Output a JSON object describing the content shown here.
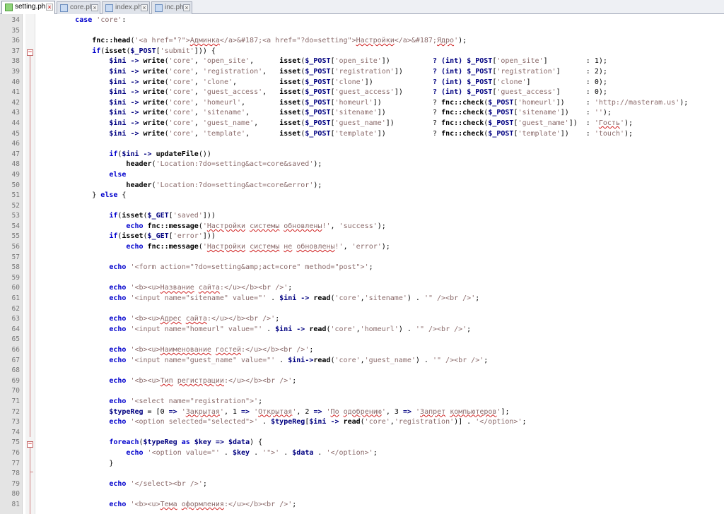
{
  "tabs": [
    {
      "label": "setting.php",
      "active": true
    },
    {
      "label": "core.php",
      "active": false
    },
    {
      "label": "index.php",
      "active": false
    },
    {
      "label": "inc.php",
      "active": false
    }
  ],
  "lines": [
    {
      "n": "34",
      "t": "        case 'core':"
    },
    {
      "n": "35",
      "t": ""
    },
    {
      "n": "36",
      "t": "            fnc::head('<a href=\"?\">Админка</a>&#187;<a href=\"?do=setting\">Настройки</a>&#187;Ядро');"
    },
    {
      "n": "37",
      "t": "            if(isset($_POST['submit'])) {"
    },
    {
      "n": "38",
      "t": "                $ini -> write('core', 'open_site',      isset($_POST['open_site'])          ? (int) $_POST['open_site']         : 1);"
    },
    {
      "n": "39",
      "t": "                $ini -> write('core', 'registration',   isset($_POST['registration'])       ? (int) $_POST['registration']      : 2);"
    },
    {
      "n": "40",
      "t": "                $ini -> write('core', 'clone',          isset($_POST['clone'])              ? (int) $_POST['clone']             : 0);"
    },
    {
      "n": "41",
      "t": "                $ini -> write('core', 'guest_access',   isset($_POST['guest_access'])       ? (int) $_POST['guest_access']      : 0);"
    },
    {
      "n": "42",
      "t": "                $ini -> write('core', 'homeurl',        isset($_POST['homeurl'])            ? fnc::check($_POST['homeurl'])     : 'http://masteram.us');"
    },
    {
      "n": "43",
      "t": "                $ini -> write('core', 'sitename',       isset($_POST['sitename'])           ? fnc::check($_POST['sitename'])    : '');"
    },
    {
      "n": "44",
      "t": "                $ini -> write('core', 'guest_name',     isset($_POST['guest_name'])         ? fnc::check($_POST['guest_name'])  : 'Гость');"
    },
    {
      "n": "45",
      "t": "                $ini -> write('core', 'template',       isset($_POST['template'])           ? fnc::check($_POST['template'])    : 'touch');"
    },
    {
      "n": "46",
      "t": ""
    },
    {
      "n": "47",
      "t": "                if($ini -> updateFile())"
    },
    {
      "n": "48",
      "t": "                    header('Location:?do=setting&act=core&saved');"
    },
    {
      "n": "49",
      "t": "                else"
    },
    {
      "n": "50",
      "t": "                    header('Location:?do=setting&act=core&error');"
    },
    {
      "n": "51",
      "t": "            } else {"
    },
    {
      "n": "52",
      "t": ""
    },
    {
      "n": "53",
      "t": "                if(isset($_GET['saved']))"
    },
    {
      "n": "54",
      "t": "                    echo fnc::message('Настройки системы обновлены!', 'success');"
    },
    {
      "n": "55",
      "t": "                if(isset($_GET['error']))"
    },
    {
      "n": "56",
      "t": "                    echo fnc::message('Настройки системы не обновлены!', 'error');"
    },
    {
      "n": "57",
      "t": ""
    },
    {
      "n": "58",
      "t": "                echo '<form action=\"?do=setting&amp;act=core\" method=\"post\">';"
    },
    {
      "n": "59",
      "t": ""
    },
    {
      "n": "60",
      "t": "                echo '<b><u>Название сайта:</u></b><br />';"
    },
    {
      "n": "61",
      "t": "                echo '<input name=\"sitename\" value=\"' . $ini -> read('core','sitename') . '\" /><br />';"
    },
    {
      "n": "62",
      "t": ""
    },
    {
      "n": "63",
      "t": "                echo '<b><u>Адрес сайта:</u></b><br />';"
    },
    {
      "n": "64",
      "t": "                echo '<input name=\"homeurl\" value=\"' . $ini -> read('core','homeurl') . '\" /><br />';"
    },
    {
      "n": "65",
      "t": ""
    },
    {
      "n": "66",
      "t": "                echo '<b><u>Наименование гостей:</u></b><br />';"
    },
    {
      "n": "67",
      "t": "                echo '<input name=\"guest_name\" value=\"' . $ini->read('core','guest_name') . '\" /><br />';"
    },
    {
      "n": "68",
      "t": ""
    },
    {
      "n": "69",
      "t": "                echo '<b><u>Тип регистрации:</u></b><br />';"
    },
    {
      "n": "70",
      "t": ""
    },
    {
      "n": "71",
      "t": "                echo '<select name=\"registration\">';"
    },
    {
      "n": "72",
      "t": "                $typeReg = [0 => 'Закрытая', 1 => 'Открытая', 2 => 'По одобрению', 3 => 'Запрет компьютеров'];"
    },
    {
      "n": "73",
      "t": "                echo '<option selected=\"selected\">' . $typeReg[$ini -> read('core','registration')] . '</option>';"
    },
    {
      "n": "74",
      "t": ""
    },
    {
      "n": "75",
      "t": "                foreach($typeReg as $key => $data) {"
    },
    {
      "n": "76",
      "t": "                    echo '<option value=\"' . $key . '\">' . $data . '</option>';"
    },
    {
      "n": "77",
      "t": "                }"
    },
    {
      "n": "78",
      "t": ""
    },
    {
      "n": "79",
      "t": "                echo '</select><br />';"
    },
    {
      "n": "80",
      "t": ""
    },
    {
      "n": "81",
      "t": "                echo '<b><u>Тема оформления:</u></b><br />';"
    }
  ]
}
